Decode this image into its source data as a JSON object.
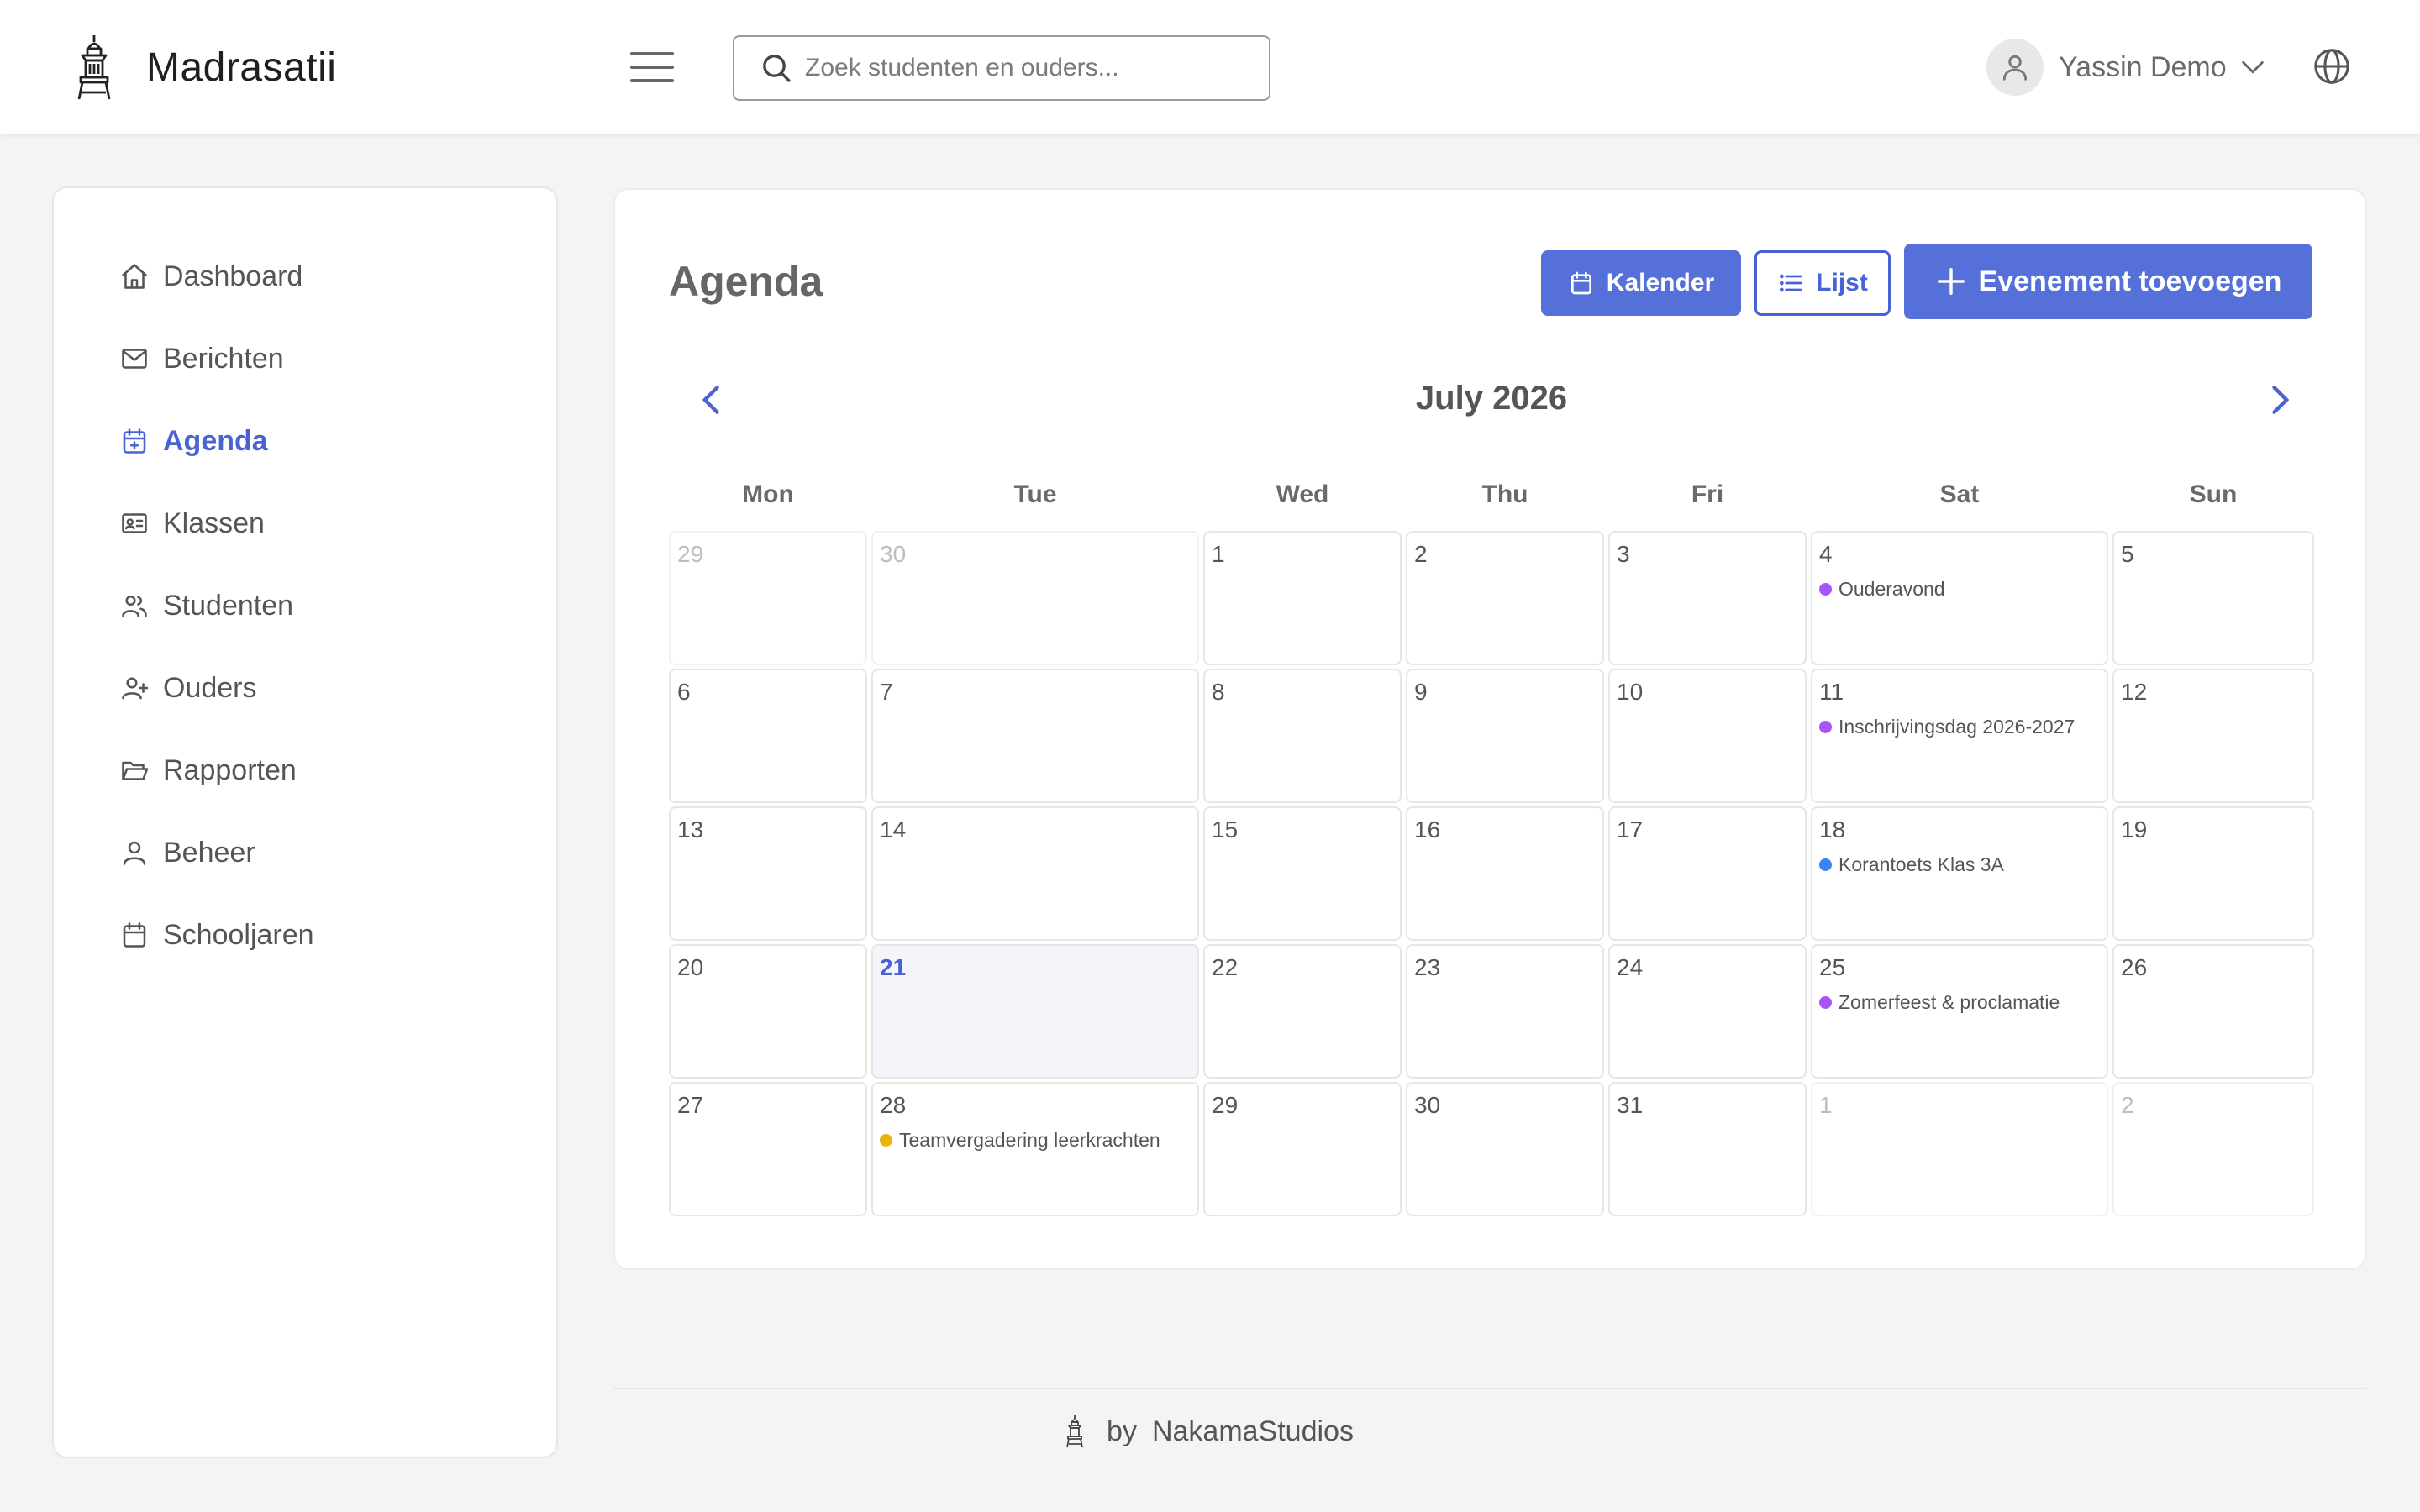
{
  "app": {
    "name": "Madrasatii"
  },
  "search": {
    "placeholder": "Zoek studenten en ouders..."
  },
  "user": {
    "name": "Yassin Demo"
  },
  "sidebar": {
    "items": [
      {
        "label": "Dashboard",
        "icon": "home-icon",
        "active": false
      },
      {
        "label": "Berichten",
        "icon": "mail-icon",
        "active": false
      },
      {
        "label": "Agenda",
        "icon": "calendar-plus-icon",
        "active": true
      },
      {
        "label": "Klassen",
        "icon": "id-card-icon",
        "active": false
      },
      {
        "label": "Studenten",
        "icon": "users-icon",
        "active": false
      },
      {
        "label": "Ouders",
        "icon": "user-plus-icon",
        "active": false
      },
      {
        "label": "Rapporten",
        "icon": "folder-open-icon",
        "active": false
      },
      {
        "label": "Beheer",
        "icon": "user-icon",
        "active": false
      },
      {
        "label": "Schooljaren",
        "icon": "calendar-icon",
        "active": false
      }
    ]
  },
  "main": {
    "title": "Agenda",
    "buttons": {
      "calendar": "Kalender",
      "list": "Lijst",
      "add_event": "Evenement toevoegen"
    },
    "month_label": "July 2026",
    "weekdays": [
      "Mon",
      "Tue",
      "Wed",
      "Thu",
      "Fri",
      "Sat",
      "Sun"
    ],
    "weeks": [
      [
        {
          "day": "29",
          "outside": true
        },
        {
          "day": "30",
          "outside": true
        },
        {
          "day": "1"
        },
        {
          "day": "2"
        },
        {
          "day": "3"
        },
        {
          "day": "4",
          "event": {
            "title": "Ouderavond",
            "color": "#a855f7"
          }
        },
        {
          "day": "5"
        }
      ],
      [
        {
          "day": "6"
        },
        {
          "day": "7"
        },
        {
          "day": "8"
        },
        {
          "day": "9"
        },
        {
          "day": "10"
        },
        {
          "day": "11",
          "event": {
            "title": "Inschrijvingsdag 2026-2027",
            "color": "#a855f7"
          }
        },
        {
          "day": "12"
        }
      ],
      [
        {
          "day": "13"
        },
        {
          "day": "14"
        },
        {
          "day": "15"
        },
        {
          "day": "16"
        },
        {
          "day": "17"
        },
        {
          "day": "18",
          "event": {
            "title": "Korantoets Klas 3A",
            "color": "#3b82f6"
          }
        },
        {
          "day": "19"
        }
      ],
      [
        {
          "day": "20"
        },
        {
          "day": "21",
          "today": true
        },
        {
          "day": "22"
        },
        {
          "day": "23"
        },
        {
          "day": "24"
        },
        {
          "day": "25",
          "event": {
            "title": "Zomerfeest & proclamatie",
            "color": "#a855f7"
          }
        },
        {
          "day": "26"
        }
      ],
      [
        {
          "day": "27"
        },
        {
          "day": "28",
          "event": {
            "title": "Teamvergadering leerkrachten",
            "color": "#eab308"
          }
        },
        {
          "day": "29"
        },
        {
          "day": "30"
        },
        {
          "day": "31"
        },
        {
          "day": "1",
          "outside": true
        },
        {
          "day": "2",
          "outside": true
        }
      ]
    ]
  },
  "footer": {
    "by": "by",
    "company": "NakamaStudios"
  },
  "colors": {
    "accent": "#5570d8",
    "active_text": "#4a63d4",
    "today_bg": "#f3f5fb"
  }
}
